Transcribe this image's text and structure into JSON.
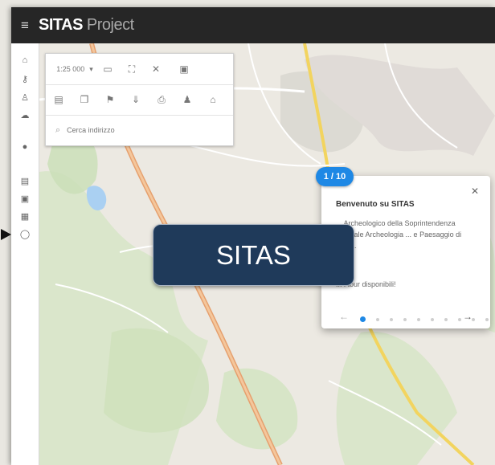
{
  "header": {
    "title_bold": "SITAS",
    "title_light": "Project",
    "menu_icon": "hamburger-menu-icon"
  },
  "sidebar": {
    "items": [
      {
        "icon": "home-icon",
        "glyph": "⌂"
      },
      {
        "icon": "key-icon",
        "glyph": "⚷"
      },
      {
        "icon": "person-walk-icon",
        "glyph": "♙"
      },
      {
        "icon": "cloud-icon",
        "glyph": "☁"
      },
      {
        "icon": "pin-icon",
        "glyph": "●"
      },
      {
        "icon": "database-icon",
        "glyph": "▤"
      },
      {
        "icon": "square-icon",
        "glyph": "▣"
      },
      {
        "icon": "layers-icon",
        "glyph": "▦"
      },
      {
        "icon": "info-icon",
        "glyph": "◯"
      }
    ]
  },
  "toolbox": {
    "scale_value": "1:25 000",
    "search_placeholder": "Cerca indirizzo",
    "row1_icons": [
      "ruler-icon",
      "frame-icon",
      "close-icon",
      "clipboard-icon"
    ],
    "row2_icons": [
      "document-icon",
      "copy-icon",
      "flag-icon",
      "pin-person-icon",
      "printer-icon",
      "bag-icon",
      "cloud-upload-icon"
    ],
    "row1_glyphs": [
      "▭",
      "⛶",
      "✕",
      "▣"
    ],
    "row2_glyphs": [
      "▤",
      "❐",
      "⚑",
      "⇓",
      "⎙",
      "♟",
      "⌂"
    ]
  },
  "tour": {
    "step": "1 / 10",
    "title": "Benvenuto su SITAS",
    "body": "... Archeologico della Soprintendenza Speciale Archeologia ... e Paesaggio di Siena.",
    "question": "... i tour disponibili!",
    "close_icon": "close-icon",
    "prev_icon": "arrow-left-icon",
    "next_icon": "arrow-right-icon",
    "current_step": 1,
    "total_steps": 10
  },
  "callout": {
    "label": "SITAS"
  },
  "colors": {
    "topbar": "#262626",
    "accent": "#1e88e5",
    "callout_bg": "#1f3a5a"
  }
}
